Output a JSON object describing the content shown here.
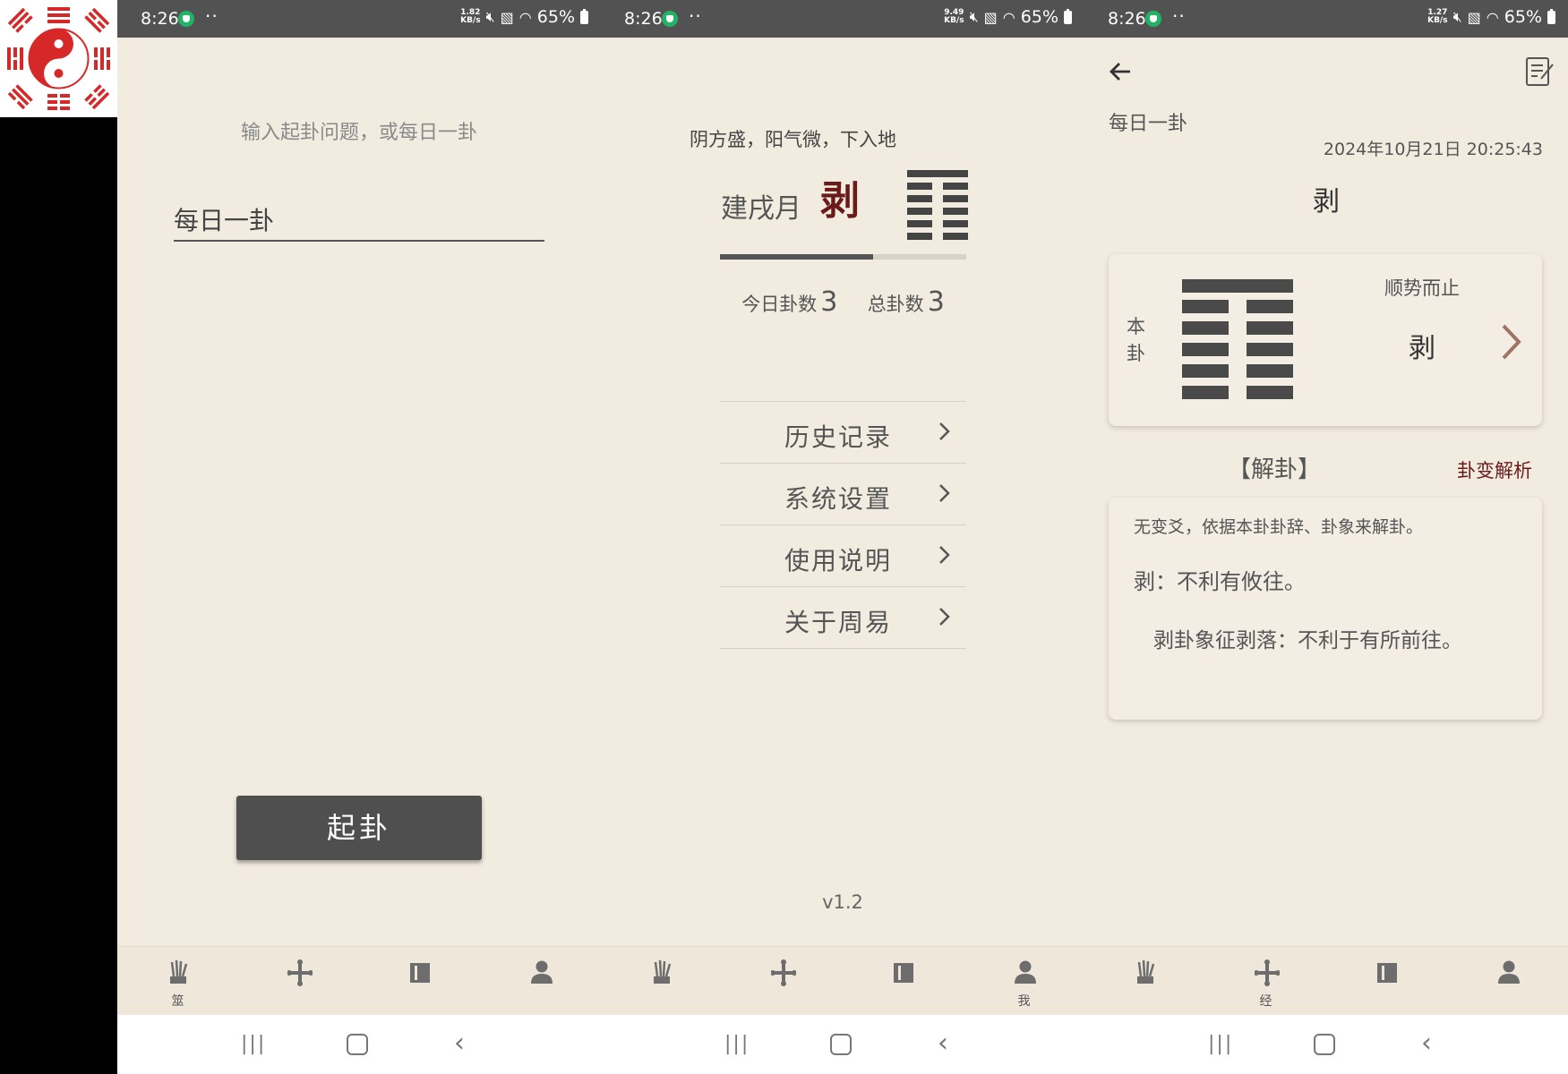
{
  "status_bar": {
    "time": "8:26",
    "dots": "··",
    "battery": "65%",
    "speed_unit": "KB/s",
    "net_speeds": [
      "1.82",
      "9.49",
      "1.27"
    ]
  },
  "bottom_nav": {
    "items": [
      {
        "icon": "yarrow-stalks-icon",
        "label": "筮"
      },
      {
        "icon": "trigram-cross-icon",
        "label": "经"
      },
      {
        "icon": "book-icon",
        "label": ""
      },
      {
        "icon": "person-icon",
        "label": "我"
      }
    ]
  },
  "panel1": {
    "hint": "输入起卦问题，或每日一卦",
    "input_value": "每日一卦",
    "button_label": "起卦"
  },
  "panel2": {
    "phrase": "阴方盛，阳气微，下入地",
    "month": "建戌月",
    "hex_name": "剥",
    "progress": 0.62,
    "today_label": "今日卦数",
    "today_count": "3",
    "total_label": "总卦数",
    "total_count": "3",
    "menu": [
      {
        "label": "历史记录"
      },
      {
        "label": "系统设置"
      },
      {
        "label": "使用说明"
      },
      {
        "label": "关于周易"
      }
    ],
    "version": "v1.2"
  },
  "panel3": {
    "title": "每日一卦",
    "datetime": "2024年10月21日 20:25:43",
    "hex_name": "剥",
    "ben_gua_label": "本卦",
    "motto": "顺势而止",
    "card_hex_name": "剥",
    "jiegua": "【解卦】",
    "analysis_link": "卦变解析",
    "text1": "无变爻，依据本卦卦辞、卦象来解卦。",
    "text2": "剥：不利有攸往。",
    "text3": "剥卦象征剥落：不利于有所前往。"
  },
  "colors": {
    "background": "#f2ebe0",
    "status_bar": "#525252",
    "button": "#4f4f4f",
    "accent_red": "#6b1a1a",
    "logo_red": "#d62828"
  }
}
